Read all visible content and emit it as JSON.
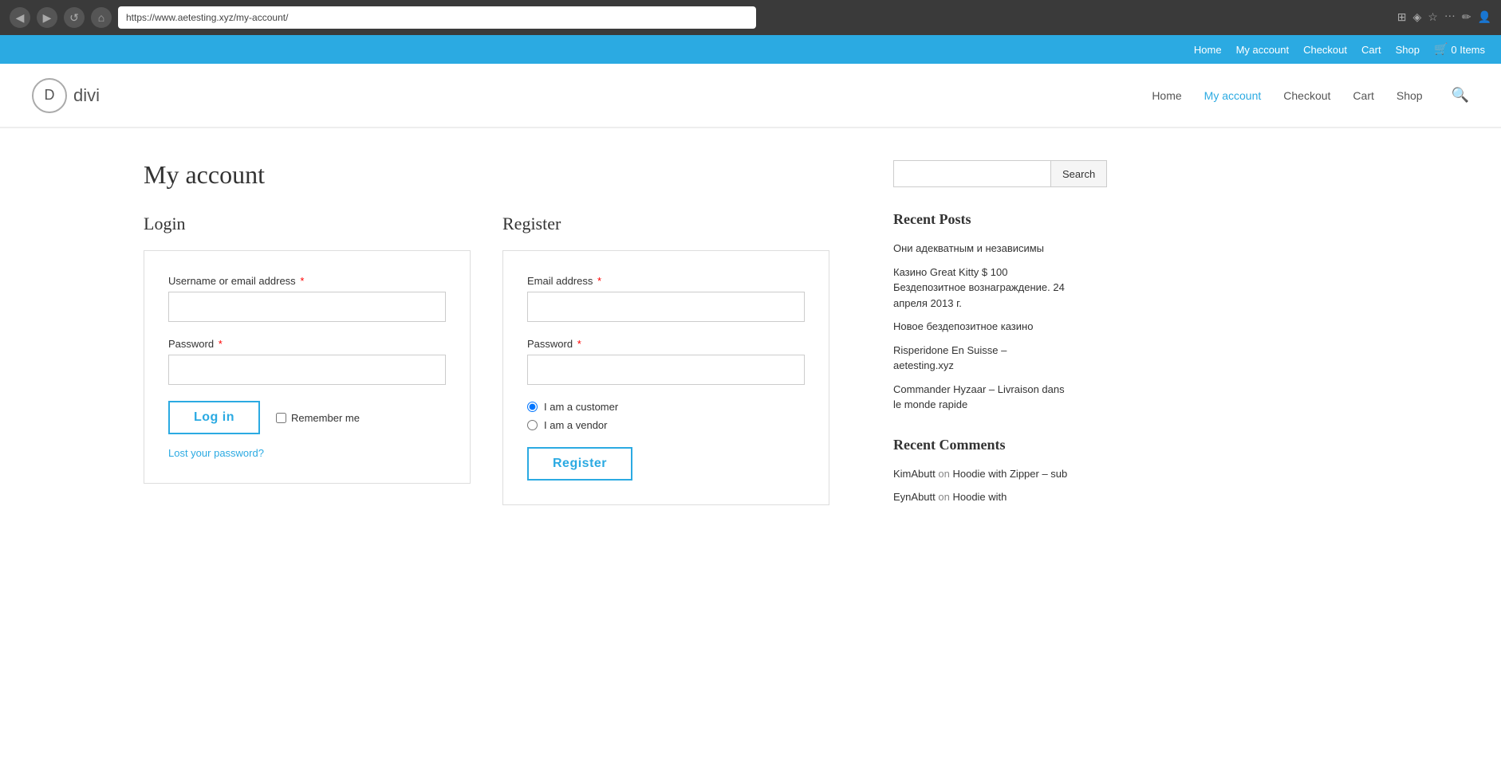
{
  "browser": {
    "url": "https://www.aetesting.xyz/my-account/",
    "back_btn": "◀",
    "forward_btn": "▶",
    "reload_btn": "↺",
    "home_btn": "⌂",
    "more_icon": "···"
  },
  "top_bar": {
    "links": [
      "Home",
      "My account",
      "Checkout",
      "Cart",
      "Shop"
    ],
    "cart_icon": "🛒",
    "cart_label": "0 Items"
  },
  "header": {
    "logo_letter": "D",
    "logo_text": "divi",
    "nav_links": [
      "Home",
      "My account",
      "Checkout",
      "Cart",
      "Shop"
    ],
    "active_nav": "My account",
    "search_icon": "🔍"
  },
  "page": {
    "title": "My account",
    "login_section": {
      "title": "Login",
      "username_label": "Username or email address",
      "password_label": "Password",
      "login_btn": "Log in",
      "remember_label": "Remember me",
      "lost_password_link": "Lost your password?"
    },
    "register_section": {
      "title": "Register",
      "email_label": "Email address",
      "password_label": "Password",
      "radio_customer": "I am a customer",
      "radio_vendor": "I am a vendor",
      "register_btn": "Register"
    }
  },
  "sidebar": {
    "search_placeholder": "",
    "search_btn_label": "Search",
    "recent_posts_title": "Recent Posts",
    "recent_posts": [
      "Они адекватным и независимы",
      "Казино Great Kitty $ 100 Бездепозитное вознаграждение. 24 апреля 2013 г.",
      "Новое бездепозитное казино",
      "Risperidone En Suisse – aetesting.xyz",
      "Commander Hyzaar – Livraison dans le monde rapide"
    ],
    "recent_comments_title": "Recent Comments",
    "recent_comments": [
      {
        "author": "KimAbutt",
        "on": "on",
        "link": "Hoodie with Zipper – sub"
      },
      {
        "author": "EynAbutt",
        "on": "on",
        "link": "Hoodie with"
      }
    ]
  }
}
